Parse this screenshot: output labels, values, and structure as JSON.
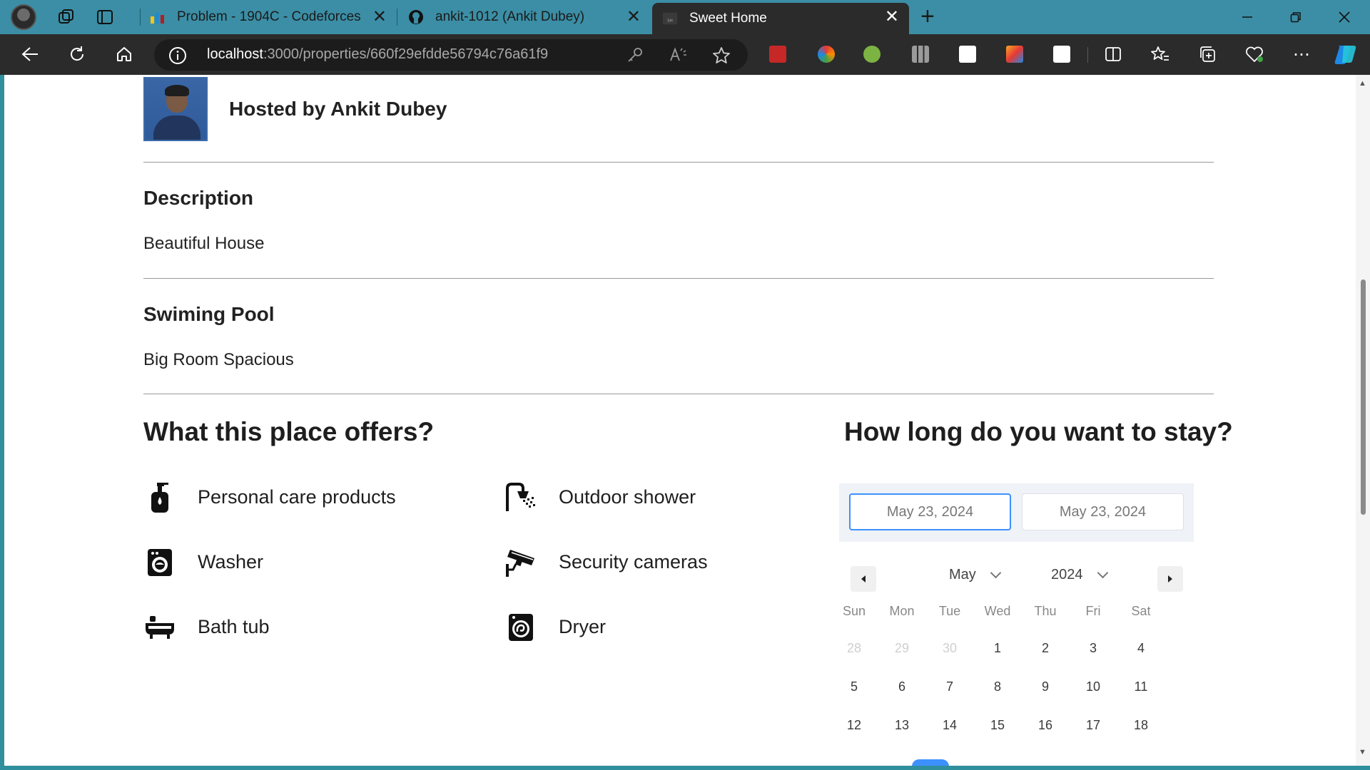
{
  "browser": {
    "tabs": [
      {
        "title": "Problem - 1904C - Codeforces",
        "favicon": "codeforces-icon"
      },
      {
        "title": "ankit-1012 (Ankit Dubey)",
        "favicon": "github-icon"
      },
      {
        "title": "Sweet Home",
        "favicon": "sweet-home-icon",
        "active": true
      }
    ],
    "url_host": "localhost",
    "url_path": ":3000/properties/660f29efdde56794c76a61f9",
    "colors": {
      "tab_strip": "#3b8ea5",
      "toolbar": "#2b2b2b",
      "active_tab": "#2b2b2b"
    }
  },
  "host": {
    "label": "Hosted by Ankit Dubey"
  },
  "description": {
    "title": "Description",
    "text": "Beautiful House"
  },
  "feature": {
    "title": "Swiming Pool",
    "text": "Big Room Spacious"
  },
  "offers": {
    "title": "What this place offers?",
    "items": [
      {
        "label": "Personal care products",
        "icon": "soap-bottle-icon"
      },
      {
        "label": "Outdoor shower",
        "icon": "shower-icon"
      },
      {
        "label": "Washer",
        "icon": "washer-icon"
      },
      {
        "label": "Security cameras",
        "icon": "security-camera-icon"
      },
      {
        "label": "Bath tub",
        "icon": "bathtub-icon"
      },
      {
        "label": "Dryer",
        "icon": "dryer-icon"
      }
    ]
  },
  "stay": {
    "title": "How long do you want to stay?",
    "start_date": "May 23, 2024",
    "end_date": "May 23, 2024",
    "month": "May",
    "year": "2024",
    "weekdays": [
      "Sun",
      "Mon",
      "Tue",
      "Wed",
      "Thu",
      "Fri",
      "Sat"
    ],
    "weeks": [
      [
        "28",
        "29",
        "30",
        "1",
        "2",
        "3",
        "4"
      ],
      [
        "5",
        "6",
        "7",
        "8",
        "9",
        "10",
        "11"
      ],
      [
        "12",
        "13",
        "14",
        "15",
        "16",
        "17",
        "18"
      ]
    ],
    "accent": "#3d91ff"
  }
}
